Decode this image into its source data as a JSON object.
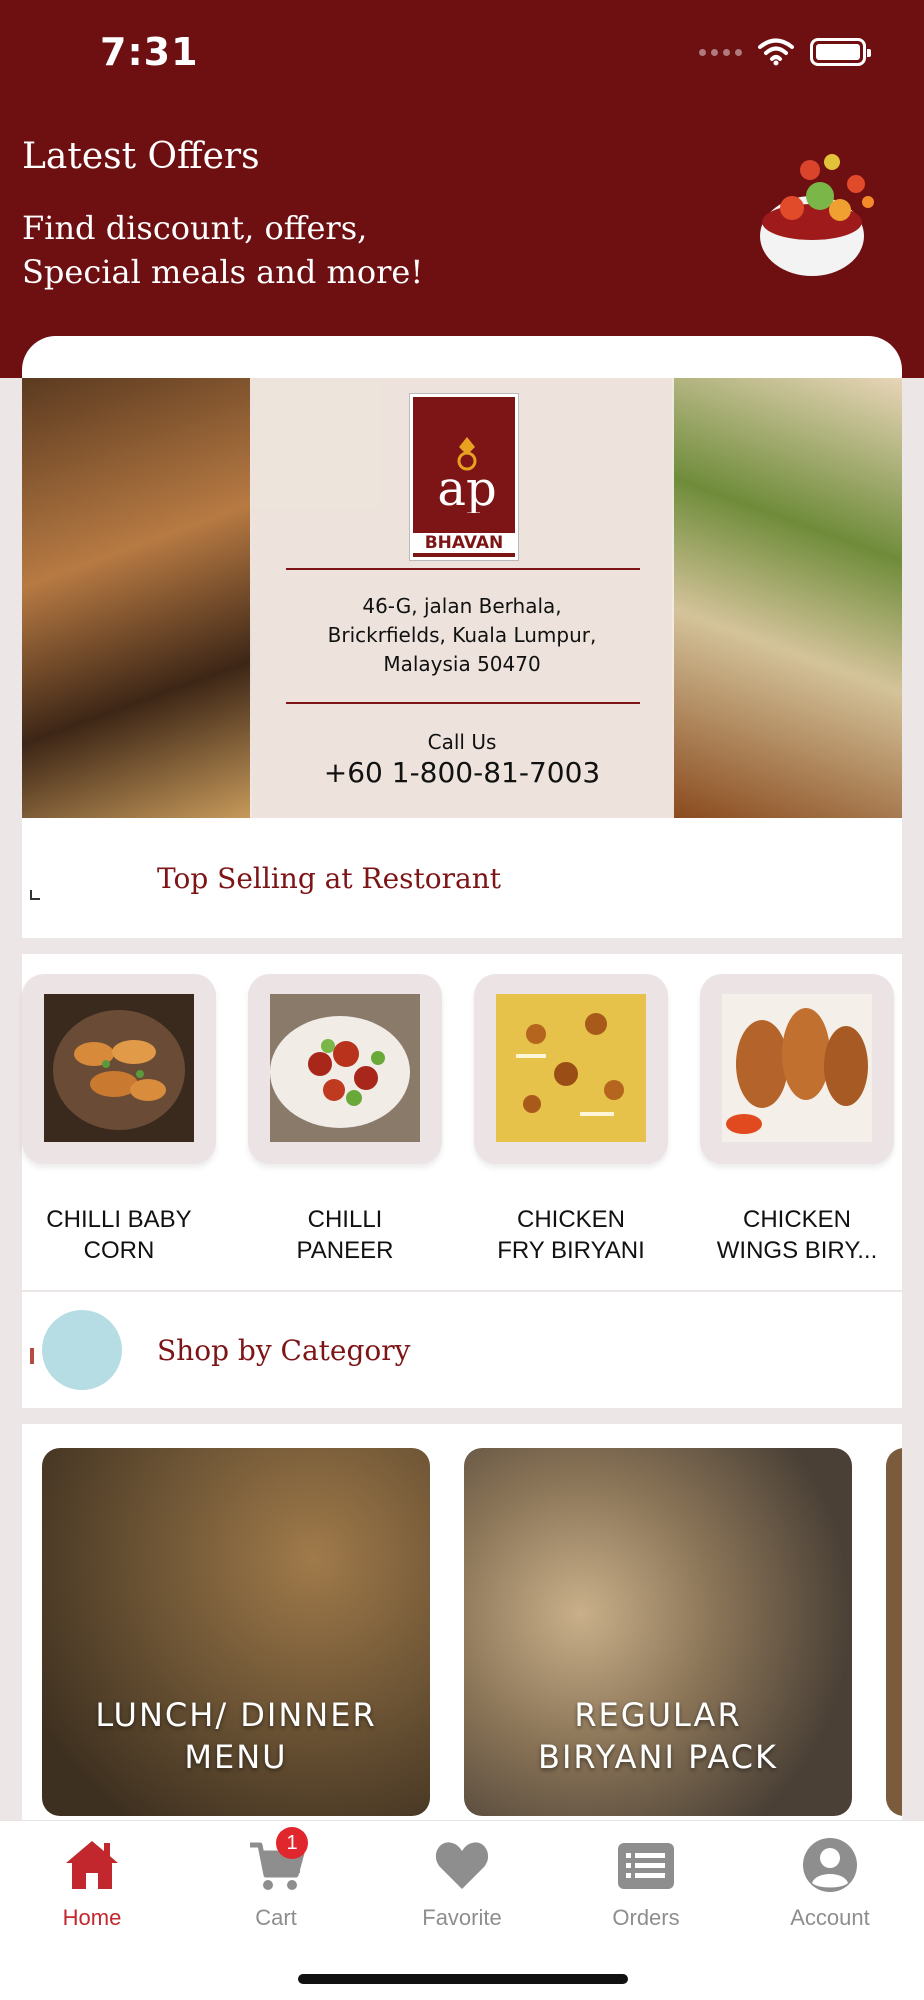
{
  "status_bar": {
    "time": "7:31"
  },
  "header": {
    "title": "Latest Offers",
    "subtitle": "Find discount, offers,\nSpecial meals and more!"
  },
  "banner": {
    "logo_text": "BHAVAN",
    "address": "46-G, jalan Berhala,\nBrickrfields, Kuala Lumpur,\nMalaysia 50470",
    "call_label": "Call Us",
    "phone": "+60 1-800-81-7003"
  },
  "top_selling": {
    "title": "Top Selling at Restorant",
    "items": [
      {
        "name": "CHILLI BABY\nCORN"
      },
      {
        "name": "CHILLI\nPANEER"
      },
      {
        "name": "CHICKEN\nFRY BIRYANI"
      },
      {
        "name": "CHICKEN\nWINGS BIRY..."
      }
    ]
  },
  "shop_by_category": {
    "title": "Shop by Category",
    "cards": [
      {
        "label": "LUNCH/ DINNER\nMENU"
      },
      {
        "label": "REGULAR\nBIRYANI PACK"
      }
    ]
  },
  "tabbar": {
    "items": [
      {
        "label": "Home",
        "icon": "home-icon",
        "active": true
      },
      {
        "label": "Cart",
        "icon": "cart-icon",
        "badge": "1"
      },
      {
        "label": "Favorite",
        "icon": "heart-icon"
      },
      {
        "label": "Orders",
        "icon": "orders-icon"
      },
      {
        "label": "Account",
        "icon": "account-icon"
      }
    ]
  },
  "colors": {
    "brand": "#6e1012",
    "accent": "#c1272d",
    "title": "#7d1416"
  }
}
